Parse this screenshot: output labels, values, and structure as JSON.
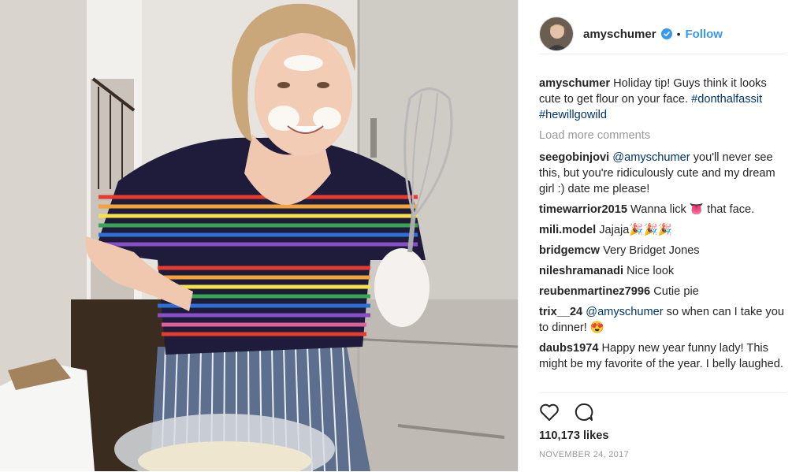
{
  "header": {
    "username": "amyschumer",
    "dot": "•",
    "follow_label": "Follow"
  },
  "caption": {
    "username": "amyschumer",
    "text": "Holiday tip! Guys think it looks cute to get flour on your face.",
    "tags": [
      "#donthalfassit",
      "#hewillgowild"
    ]
  },
  "load_more": "Load more comments",
  "comments": [
    {
      "user": "seegobinjovi",
      "mention": "@amyschumer",
      "text": "you'll never see this, but you're ridiculously cute and my dream girl :) date me please!"
    },
    {
      "user": "timewarrior2015",
      "text": "Wanna lick 👅 that face."
    },
    {
      "user": "mili.model",
      "text": "Jajaja🎉🎉🎉"
    },
    {
      "user": "bridgemcw",
      "text": "Very Bridget Jones"
    },
    {
      "user": "nileshramanadi",
      "text": "Nice look"
    },
    {
      "user": "reubenmartinez7996",
      "text": "Cutie pie"
    },
    {
      "user": "trix__24",
      "mention": "@amyschumer",
      "text": "so when can I take you to dinner! 😍"
    },
    {
      "user": "daubs1974",
      "text": "Happy new year funny lady! This might be my favorite of the year. I belly laughed."
    }
  ],
  "likes": "110,173 likes",
  "date": "NOVEMBER 24, 2017",
  "icons": {
    "like": "heart-icon",
    "comment": "comment-bubble-icon",
    "verified": "verified-badge-icon"
  },
  "colors": {
    "accent": "#3897f0",
    "mention": "#003569",
    "muted": "#999999"
  }
}
